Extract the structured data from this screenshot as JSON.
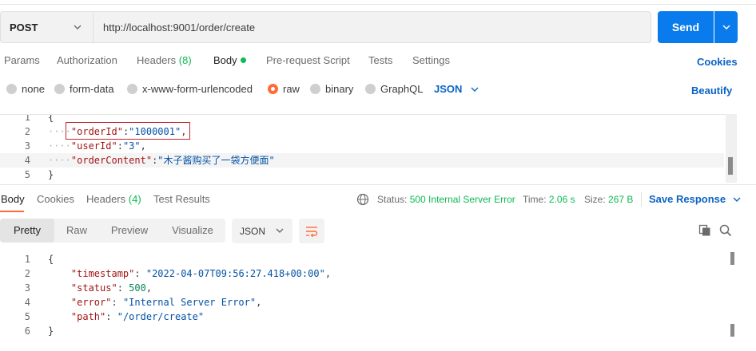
{
  "request": {
    "method": "POST",
    "url": "http://localhost:9001/order/create",
    "send_label": "Send"
  },
  "request_tabs": {
    "params": "Params",
    "authorization": "Authorization",
    "headers": "Headers",
    "headers_count": "(8)",
    "body": "Body",
    "prerequest": "Pre-request Script",
    "tests": "Tests",
    "settings": "Settings",
    "cookies": "Cookies"
  },
  "body_types": {
    "none": "none",
    "form_data": "form-data",
    "urlencoded": "x-www-form-urlencoded",
    "raw": "raw",
    "binary": "binary",
    "graphql": "GraphQL",
    "format": "JSON",
    "beautify": "Beautify"
  },
  "request_body": [
    {
      "num": "1",
      "text": "{"
    },
    {
      "num": "2",
      "key": "\"orderId\"",
      "value": "\"1000001\"",
      "trail": ","
    },
    {
      "num": "3",
      "key": "\"userId\"",
      "value": "\"3\"",
      "trail": ","
    },
    {
      "num": "4",
      "key": "\"orderContent\"",
      "value": "\"木子酱购买了一袋方便面\"",
      "trail": ""
    },
    {
      "num": "5",
      "text": "}"
    }
  ],
  "response_tabs": {
    "body": "Body",
    "cookies": "Cookies",
    "headers": "Headers",
    "headers_count": "(4)",
    "test_results": "Test Results"
  },
  "response_meta": {
    "status_label": "Status:",
    "status_value": "500 Internal Server Error",
    "time_label": "Time:",
    "time_value": "2.06 s",
    "size_label": "Size:",
    "size_value": "267 B",
    "save_response": "Save Response"
  },
  "view_modes": {
    "pretty": "Pretty",
    "raw": "Raw",
    "preview": "Preview",
    "visualize": "Visualize",
    "format": "JSON"
  },
  "response_body": [
    {
      "num": "1",
      "text": "{"
    },
    {
      "num": "2",
      "key": "\"timestamp\"",
      "value": "\"2022-04-07T09:56:27.418+00:00\"",
      "trail": ","
    },
    {
      "num": "3",
      "key": "\"status\"",
      "number": "500",
      "trail": ","
    },
    {
      "num": "4",
      "key": "\"error\"",
      "value": "\"Internal Server Error\"",
      "trail": ","
    },
    {
      "num": "5",
      "key": "\"path\"",
      "value": "\"/order/create\"",
      "trail": ""
    },
    {
      "num": "6",
      "text": "}"
    }
  ],
  "colors": {
    "accent": "#ff6c37",
    "send": "#097bed",
    "link": "#0b63c5",
    "success": "#0cbb52"
  }
}
